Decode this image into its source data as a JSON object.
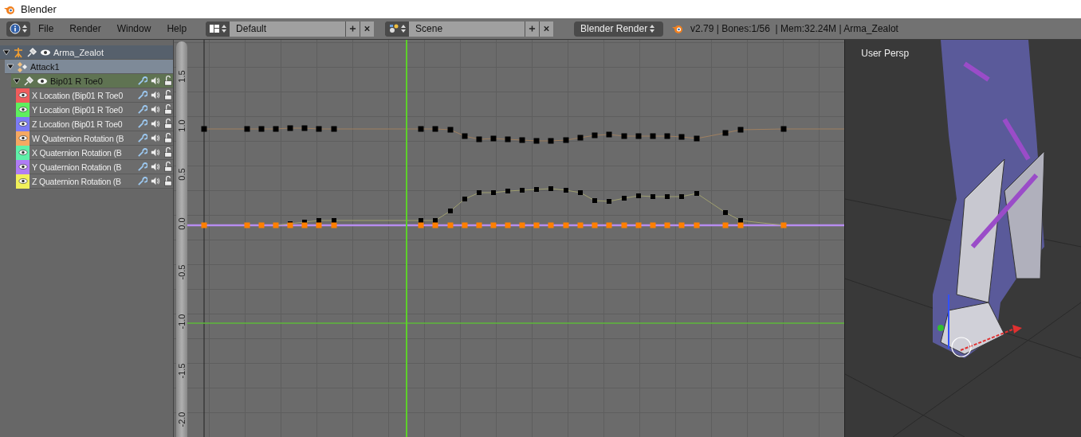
{
  "window": {
    "title": "Blender"
  },
  "header": {
    "menus": [
      "File",
      "Render",
      "Window",
      "Help"
    ],
    "screen_layout": "Default",
    "scene": "Scene",
    "render_engine": "Blender Render",
    "stats": "v2.79 | Bones:1/56  | Mem:32.24M | Arma_Zealot"
  },
  "channels": [
    {
      "kind": "object",
      "name": "Arma_Zealot",
      "expanded": true
    },
    {
      "kind": "action",
      "name": "Attack1",
      "expanded": true
    },
    {
      "kind": "group",
      "name": "Bip01 R Toe0",
      "expanded": true
    },
    {
      "kind": "fcurve",
      "name": "X Location (Bip01 R Toe0",
      "color": "#f05c5c"
    },
    {
      "kind": "fcurve",
      "name": "Y Location (Bip01 R Toe0",
      "color": "#5ef05e"
    },
    {
      "kind": "fcurve",
      "name": "Z Location (Bip01 R Toe0",
      "color": "#7b7bf5"
    },
    {
      "kind": "fcurve",
      "name": "W Quaternion Rotation (B",
      "color": "#f5a862"
    },
    {
      "kind": "fcurve",
      "name": "X Quaternion Rotation (B",
      "color": "#5ef0a8"
    },
    {
      "kind": "fcurve",
      "name": "Y Quaternion Rotation (B",
      "color": "#b07cf5"
    },
    {
      "kind": "fcurve",
      "name": "Z Quaternion Rotation (B",
      "color": "#f0f05a"
    }
  ],
  "graph": {
    "y_axis_labels": [
      "1.5",
      "1.0",
      "0.5",
      "0.0",
      "-0.5",
      "-1.0",
      "-1.5",
      "-2.0"
    ]
  },
  "viewport": {
    "label": "User Persp"
  }
}
